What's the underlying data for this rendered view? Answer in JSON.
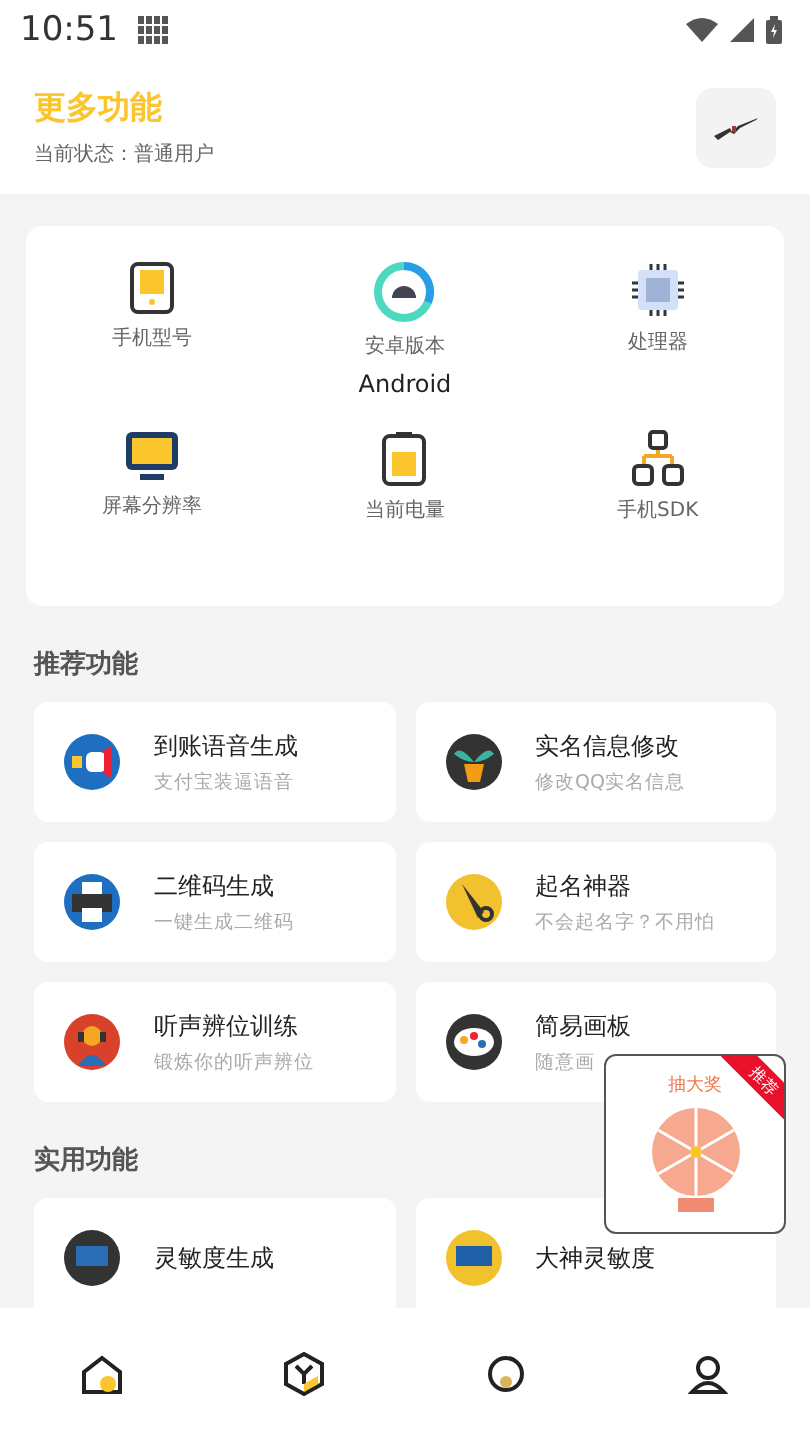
{
  "status_bar": {
    "time": "10:51"
  },
  "header": {
    "title": "更多功能",
    "subtitle": "当前状态：普通用户"
  },
  "device_info": [
    {
      "kind": "phone",
      "label": "手机型号"
    },
    {
      "kind": "android",
      "label": "安卓版本",
      "value": "Android"
    },
    {
      "kind": "cpu",
      "label": "处理器"
    },
    {
      "kind": "screen",
      "label": "屏幕分辨率"
    },
    {
      "kind": "battery",
      "label": "当前电量"
    },
    {
      "kind": "sdk",
      "label": "手机SDK"
    }
  ],
  "sections": [
    {
      "title": "推荐功能",
      "items": [
        {
          "kind": "money",
          "title": "到账语音生成",
          "subtitle": "支付宝装逼语音"
        },
        {
          "kind": "plant",
          "title": "实名信息修改",
          "subtitle": "修改QQ实名信息"
        },
        {
          "kind": "printer",
          "title": "二维码生成",
          "subtitle": "一键生成二维码"
        },
        {
          "kind": "pen",
          "title": "起名神器",
          "subtitle": "不会起名字？不用怕"
        },
        {
          "kind": "person",
          "title": "听声辨位训练",
          "subtitle": "锻炼你的听声辨位"
        },
        {
          "kind": "palette",
          "title": "简易画板",
          "subtitle": "随意画"
        }
      ]
    },
    {
      "title": "实用功能",
      "items": [
        {
          "kind": "monitor",
          "title": "灵敏度生成"
        },
        {
          "kind": "folder",
          "title": "大神灵敏度"
        }
      ]
    }
  ],
  "promo": {
    "title": "抽大奖",
    "tag": "推荐"
  },
  "bottom_nav": [
    {
      "kind": "home"
    },
    {
      "kind": "cube"
    },
    {
      "kind": "dot"
    },
    {
      "kind": "user"
    }
  ]
}
